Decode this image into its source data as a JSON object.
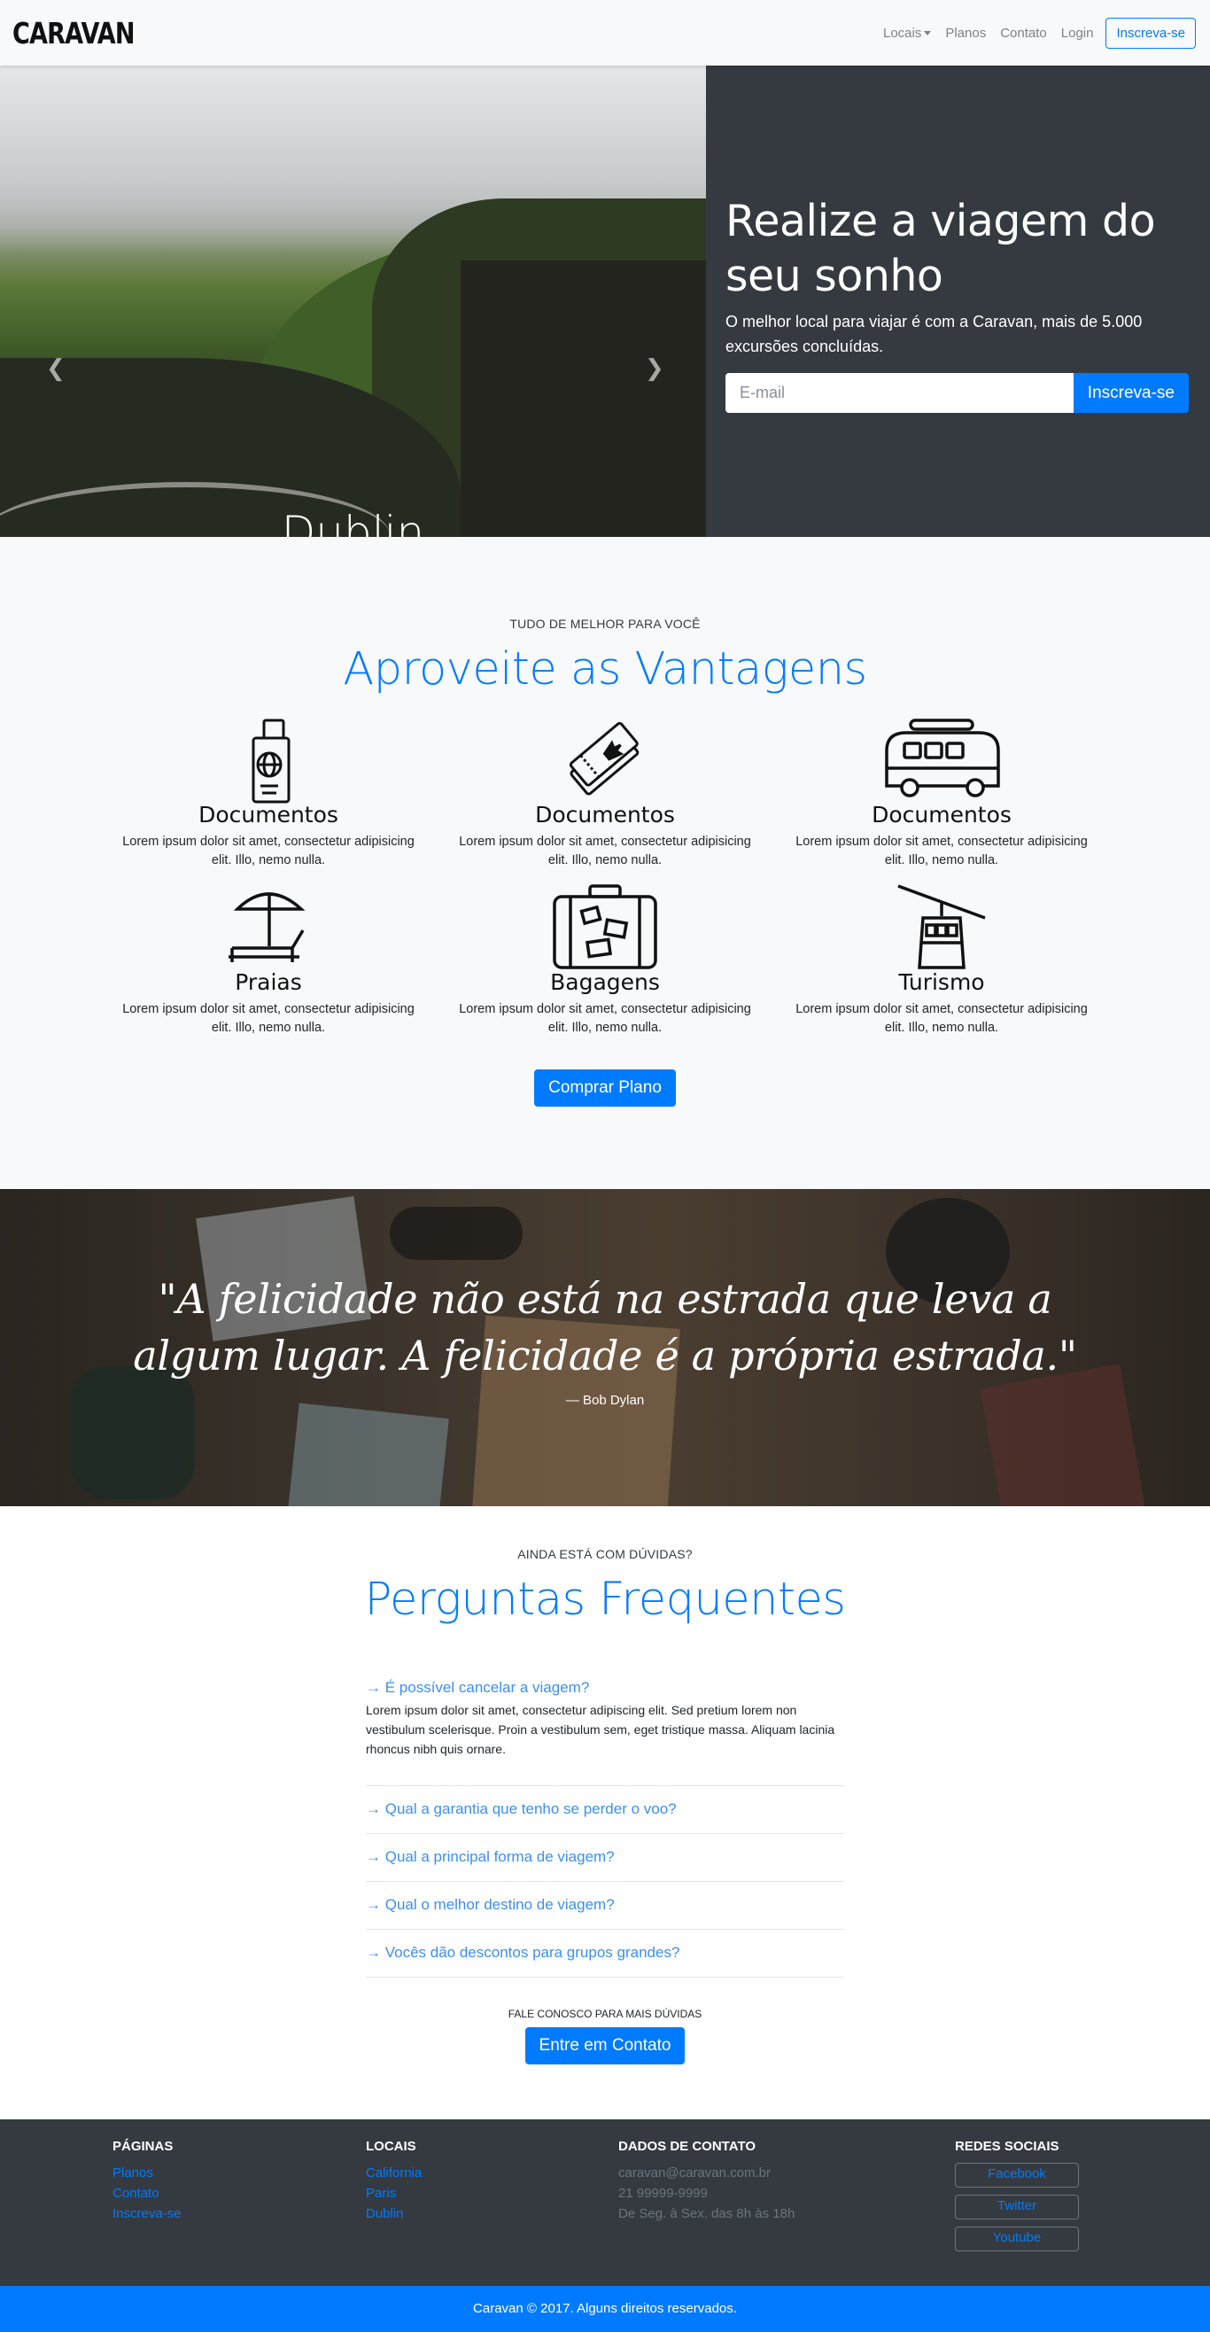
{
  "navbar": {
    "brand": "CARAVAN",
    "links": [
      "Locais",
      "Planos",
      "Contato",
      "Login"
    ],
    "cta": "Inscreva-se"
  },
  "hero": {
    "carousel_caption": "Dublin",
    "carousel_slides": 3,
    "active_slide": 2,
    "headline": "Realize a viagem do seu sonho",
    "description": "O melhor local para viajar é com a Caravan, mais de 5.000 excursões concluídas.",
    "email_placeholder": "E-mail",
    "signup_button": "Inscreva-se"
  },
  "vantagens": {
    "eyebrow": "TUDO DE MELHOR PARA VOCÊ",
    "title": "Aproveite as Vantagens",
    "features": [
      {
        "icon": "passport-icon",
        "title": "Documentos",
        "text": "Lorem ipsum dolor sit amet, consectetur adipisicing elit. Illo, nemo nulla."
      },
      {
        "icon": "tickets-icon",
        "title": "Documentos",
        "text": "Lorem ipsum dolor sit amet, consectetur adipisicing elit. Illo, nemo nulla."
      },
      {
        "icon": "van-icon",
        "title": "Documentos",
        "text": "Lorem ipsum dolor sit amet, consectetur adipisicing elit. Illo, nemo nulla."
      },
      {
        "icon": "beach-chair-icon",
        "title": "Praias",
        "text": "Lorem ipsum dolor sit amet, consectetur adipisicing elit. Illo, nemo nulla."
      },
      {
        "icon": "suitcase-icon",
        "title": "Bagagens",
        "text": "Lorem ipsum dolor sit amet, consectetur adipisicing elit. Illo, nemo nulla."
      },
      {
        "icon": "cable-car-icon",
        "title": "Turismo",
        "text": "Lorem ipsum dolor sit amet, consectetur adipisicing elit. Illo, nemo nulla."
      }
    ],
    "button": "Comprar Plano"
  },
  "quote": {
    "text": "\"A felicidade não está na estrada que leva a algum lugar. A felicidade é a própria estrada.\"",
    "author": "— Bob Dylan"
  },
  "faq": {
    "eyebrow": "AINDA ESTÁ COM DÚVIDAS?",
    "title": "Perguntas Frequentes",
    "items": [
      {
        "question": "→ É possível cancelar a viagem?",
        "answer": "Lorem ipsum dolor sit amet, consectetur adipiscing elit. Sed pretium lorem non vestibulum scelerisque. Proin a vestibulum sem, eget tristique massa. Aliquam lacinia rhoncus nibh quis ornare."
      },
      {
        "question": "→ Qual a garantia que tenho se perder o voo?"
      },
      {
        "question": "→ Qual a principal forma de viagem?"
      },
      {
        "question": "→ Qual o melhor destino de viagem?"
      },
      {
        "question": "→ Vocês dão descontos para grupos grandes?"
      }
    ],
    "cta_text": "FALE CONOSCO PARA MAIS DÚVIDAS",
    "cta_button": "Entre em Contato"
  },
  "footer": {
    "pages": {
      "title": "PÁGINAS",
      "links": [
        "Planos",
        "Contato",
        "Inscreva-se"
      ]
    },
    "locais": {
      "title": "LOCAIS",
      "links": [
        "California",
        "Paris",
        "Dublin"
      ]
    },
    "contato": {
      "title": "DADOS DE CONTATO",
      "lines": [
        "caravan@caravan.com.br",
        "21 99999-9999",
        "De Seg. à Sex. das 8h às 18h"
      ]
    },
    "social": {
      "title": "REDES SOCIAIS",
      "links": [
        "Facebook",
        "Twitter",
        "Youtube"
      ]
    },
    "copyright": "Caravan © 2017. Alguns direitos reservados."
  },
  "colors": {
    "primary": "#007bff",
    "dark": "#343a40",
    "light": "#f8f9fa"
  }
}
